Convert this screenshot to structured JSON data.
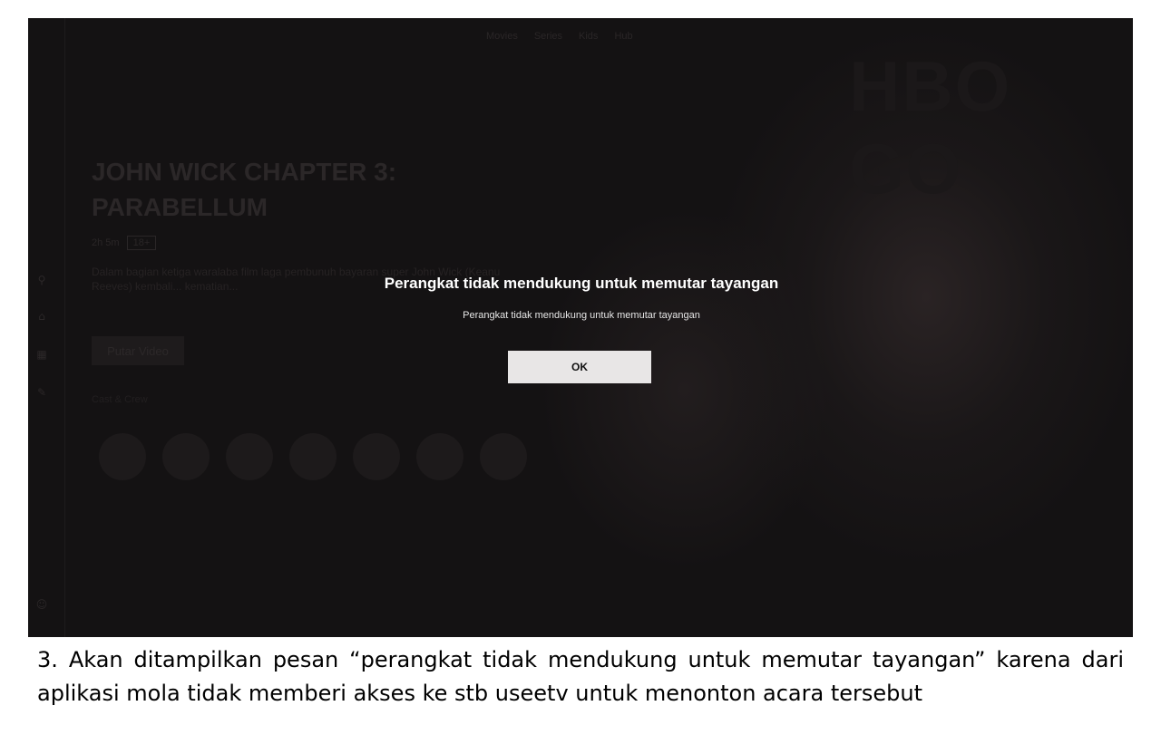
{
  "app": {
    "logo": "HBO GO",
    "nav": [
      "Movies",
      "Series",
      "Kids",
      "Hub"
    ]
  },
  "sidebar": {
    "icons": [
      "search-icon",
      "home-icon",
      "grid-icon",
      "edit-icon",
      "profile-icon"
    ]
  },
  "content": {
    "title": "JOHN WICK CHAPTER 3: PARABELLUM",
    "duration": "2h 5m",
    "rating": "18+",
    "description": "Dalam bagian ketiga waralaba film laga pembunuh bayaran super John Wick (Keanu Reeves) kembali... kematian...",
    "play_label": "Putar Video",
    "cast_label": "Cast & Crew",
    "cast_count": 7
  },
  "dialog": {
    "title": "Perangkat tidak mendukung untuk memutar tayangan",
    "message": "Perangkat tidak mendukung untuk memutar tayangan",
    "ok_label": "OK"
  },
  "caption": "3. Akan ditampilkan pesan “perangkat tidak mendukung untuk memutar tayangan” karena dari aplikasi mola tidak memberi akses ke stb useetv untuk menonton acara tersebut",
  "colors": {
    "screen_bg": "#141213",
    "dialog_text": "#ffffff",
    "ok_button_bg": "#e8e6e6",
    "page_bg": "#ffffff"
  }
}
